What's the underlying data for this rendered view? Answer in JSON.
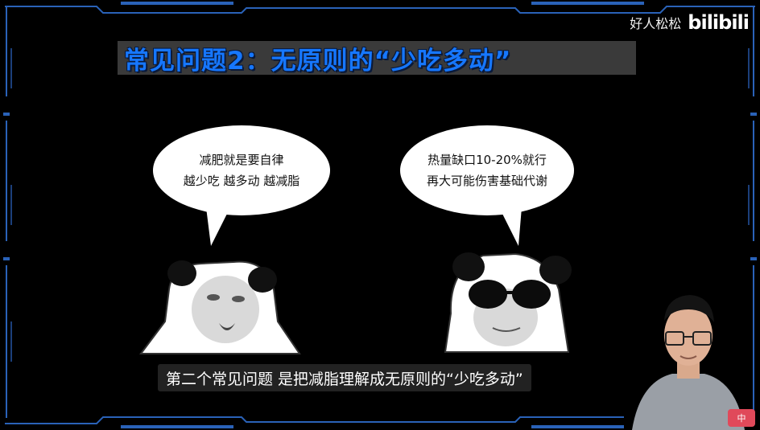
{
  "slide": {
    "title": "常见问题2：无原则的“少吃多动”",
    "left_bubble": {
      "line1": "减肥就是要自律",
      "line2": "越少吃 越多动 越减脂"
    },
    "right_bubble": {
      "line1": "热量缺口10-20%就行",
      "line2": "再大可能伤害基础代谢"
    }
  },
  "watermark": {
    "user": "好人松松",
    "logo": "bilibili"
  },
  "subtitle": "第二个常见问题 是把减脂理解成无原则的“少吃多动”",
  "badge": "中",
  "colors": {
    "title_blue": "#1677ff",
    "frame_blue": "#2a62b8",
    "background": "#000000",
    "badge": "#e0495a"
  }
}
